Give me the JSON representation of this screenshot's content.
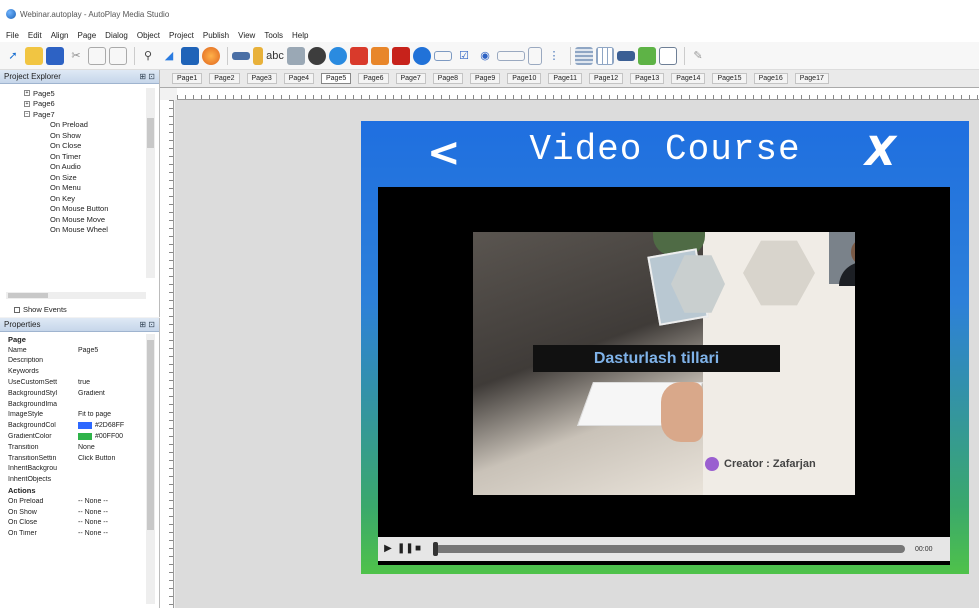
{
  "window": {
    "title": "Webinar.autoplay - AutoPlay Media Studio"
  },
  "menu": [
    "File",
    "Edit",
    "Align",
    "Page",
    "Dialog",
    "Object",
    "Project",
    "Publish",
    "View",
    "Tools",
    "Help"
  ],
  "project_explorer": {
    "title": "Project Explorer",
    "pages": [
      "Page5",
      "Page6",
      "Page7"
    ],
    "events": [
      "On Preload",
      "On Show",
      "On Close",
      "On Timer",
      "On Audio",
      "On Size",
      "On Menu",
      "On Key",
      "On Mouse Button",
      "On Mouse Move",
      "On Mouse Wheel"
    ],
    "show_events_label": "Show Events"
  },
  "properties": {
    "title": "Properties",
    "section_page": "Page",
    "rows": [
      {
        "k": "Name",
        "v": "Page5"
      },
      {
        "k": "Description",
        "v": ""
      },
      {
        "k": "Keywords",
        "v": ""
      },
      {
        "k": "UseCustomSett",
        "v": "true"
      },
      {
        "k": "BackgroundStyl",
        "v": "Gradient"
      },
      {
        "k": "BackgroundIma",
        "v": ""
      },
      {
        "k": "ImageStyle",
        "v": "Fit to page"
      }
    ],
    "color_rows": [
      {
        "k": "BackgroundCol",
        "v": "#2D68FF",
        "color": "#2d68ff"
      },
      {
        "k": "GradientColor",
        "v": "#00FF00",
        "color": "#2fb34a"
      }
    ],
    "rows2": [
      {
        "k": "Transition",
        "v": "None"
      },
      {
        "k": "TransitionSettin",
        "v": "Click Button"
      },
      {
        "k": "InheritBackgrou",
        "v": ""
      },
      {
        "k": "InheritObjects",
        "v": ""
      }
    ],
    "section_actions": "Actions",
    "actions": [
      {
        "k": "On Preload",
        "v": "-- None --"
      },
      {
        "k": "On Show",
        "v": "-- None --"
      },
      {
        "k": "On Close",
        "v": "-- None --"
      },
      {
        "k": "On Timer",
        "v": "-- None --"
      }
    ]
  },
  "page_tabs": [
    "Page1",
    "Page2",
    "Page3",
    "Page4",
    "Page5",
    "Page6",
    "Page7",
    "Page8",
    "Page9",
    "Page10",
    "Page11",
    "Page12",
    "Page13",
    "Page14",
    "Page15",
    "Page16",
    "Page17"
  ],
  "active_tab_index": 4,
  "stage": {
    "title": "Video Course",
    "back_symbol": "<",
    "close_symbol": "X",
    "gradient_top": "#1f6fe0",
    "gradient_bottom": "#4fc24a"
  },
  "video": {
    "course_label": "Dasturlash tillari",
    "creator": "Creator : Zafarjan",
    "time": "00:00"
  }
}
